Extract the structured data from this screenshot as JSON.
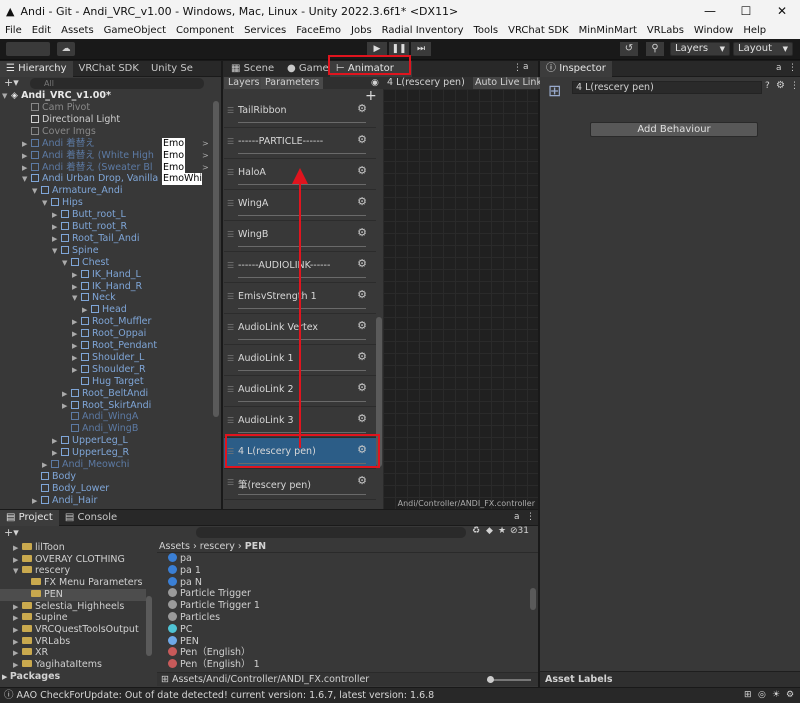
{
  "window": {
    "title": "Andi - Git - Andi_VRC_v1.00 - Windows, Mac, Linux - Unity 2022.3.6f1* <DX11>",
    "min": "—",
    "max": "☐",
    "close": "✕"
  },
  "menu": [
    "File",
    "Edit",
    "Assets",
    "GameObject",
    "Component",
    "Services",
    "FaceEmo",
    "Jobs",
    "Radial Inventory",
    "Tools",
    "VRChat SDK",
    "MinMinMart",
    "VRLabs",
    "Window",
    "Help"
  ],
  "toolbar": {
    "layers": "Layers",
    "layout": "Layout"
  },
  "hierarchy": {
    "tabs": [
      "Hierarchy",
      "VRChat SDK",
      "Unity Se"
    ],
    "search_placeholder": "All",
    "scene_name": "Andi_VRC_v1.00*",
    "rows": [
      {
        "text": "Cam Pivot",
        "indent": 2,
        "style": "dim",
        "arrow": ""
      },
      {
        "text": "Directional Light",
        "indent": 2,
        "style": "",
        "arrow": ""
      },
      {
        "text": "Cover Imgs",
        "indent": 2,
        "style": "dim",
        "arrow": ""
      },
      {
        "text": "Andi 着替え",
        "indent": 2,
        "style": "bluedim",
        "arrow": "▶",
        "badge": "Emo"
      },
      {
        "text": "Andi 着替え (White High",
        "indent": 2,
        "style": "bluedim",
        "arrow": "▶",
        "badge": "Emo"
      },
      {
        "text": "Andi 着替え (Sweater Bl",
        "indent": 2,
        "style": "bluedim",
        "arrow": "▶",
        "badge": "Emo"
      },
      {
        "text": "Andi Urban Drop, Vanilla",
        "indent": 2,
        "style": "blue",
        "arrow": "▼",
        "badge": "Emo",
        "badge2": "Whi"
      },
      {
        "text": "Armature_Andi",
        "indent": 3,
        "style": "blue",
        "arrow": "▼"
      },
      {
        "text": "Hips",
        "indent": 4,
        "style": "blue",
        "arrow": "▼"
      },
      {
        "text": "Butt_root_L",
        "indent": 5,
        "style": "blue",
        "arrow": "▶"
      },
      {
        "text": "Butt_root_R",
        "indent": 5,
        "style": "blue",
        "arrow": "▶"
      },
      {
        "text": "Root_Tail_Andi",
        "indent": 5,
        "style": "blue",
        "arrow": "▶"
      },
      {
        "text": "Spine",
        "indent": 5,
        "style": "blue",
        "arrow": "▼"
      },
      {
        "text": "Chest",
        "indent": 6,
        "style": "blue",
        "arrow": "▼"
      },
      {
        "text": "IK_Hand_L",
        "indent": 7,
        "style": "blue",
        "arrow": "▶"
      },
      {
        "text": "IK_Hand_R",
        "indent": 7,
        "style": "blue",
        "arrow": "▶"
      },
      {
        "text": "Neck",
        "indent": 7,
        "style": "blue",
        "arrow": "▼"
      },
      {
        "text": "Head",
        "indent": 8,
        "style": "blue",
        "arrow": "▶"
      },
      {
        "text": "Root_Muffler",
        "indent": 7,
        "style": "blue",
        "arrow": "▶"
      },
      {
        "text": "Root_Oppai",
        "indent": 7,
        "style": "blue",
        "arrow": "▶"
      },
      {
        "text": "Root_Pendant",
        "indent": 7,
        "style": "blue",
        "arrow": "▶"
      },
      {
        "text": "Shoulder_L",
        "indent": 7,
        "style": "blue",
        "arrow": "▶"
      },
      {
        "text": "Shoulder_R",
        "indent": 7,
        "style": "blue",
        "arrow": "▶"
      },
      {
        "text": "Hug Target",
        "indent": 7,
        "style": "blue",
        "arrow": ""
      },
      {
        "text": "Root_BeltAndi",
        "indent": 6,
        "style": "blue",
        "arrow": "▶"
      },
      {
        "text": "Root_SkirtAndi",
        "indent": 6,
        "style": "blue",
        "arrow": "▶"
      },
      {
        "text": "Andi_WingA",
        "indent": 6,
        "style": "bluedim",
        "arrow": ""
      },
      {
        "text": "Andi_WingB",
        "indent": 6,
        "style": "bluedim",
        "arrow": ""
      },
      {
        "text": "UpperLeg_L",
        "indent": 5,
        "style": "blue",
        "arrow": "▶"
      },
      {
        "text": "UpperLeg_R",
        "indent": 5,
        "style": "blue",
        "arrow": "▶"
      },
      {
        "text": "Andi_Meowchi",
        "indent": 4,
        "style": "bluedim",
        "arrow": "▶"
      },
      {
        "text": "Body",
        "indent": 3,
        "style": "blue",
        "arrow": ""
      },
      {
        "text": "Body_Lower",
        "indent": 3,
        "style": "blue",
        "arrow": ""
      },
      {
        "text": "Andi_Hair",
        "indent": 3,
        "style": "blue",
        "arrow": "▶"
      }
    ]
  },
  "center_tabs": {
    "scene": "Scene",
    "game": "Game",
    "animator": "Animator"
  },
  "animator": {
    "sub_tabs": [
      "Layers",
      "Parameters"
    ],
    "layer_name": "4 L(rescery pen)",
    "auto_live_link": "Auto Live Link",
    "add_symbol": "+",
    "params": [
      "TailRibbon",
      "------PARTICLE------",
      "HaloA",
      "WingA",
      "WingB",
      "------AUDIOLINK------",
      "EmisvStrength 1",
      "AudioLink Vertex",
      "AudioLink 1",
      "AudioLink 2",
      "AudioLink 3",
      "4 L(rescery pen)",
      "筆(rescery pen)"
    ],
    "selected_index": 11,
    "controller_path": "Andi/Controller/ANDI_FX.controller"
  },
  "inspector": {
    "tab": "Inspector",
    "object_name": "4 L(rescery pen)",
    "add_behaviour": "Add Behaviour",
    "asset_labels": "Asset Labels"
  },
  "project": {
    "tabs": [
      "Project",
      "Console"
    ],
    "count": "31",
    "folders": [
      {
        "name": "lilToon",
        "indent": 1,
        "arrow": "▶"
      },
      {
        "name": "OVERAY CLOTHING",
        "indent": 1,
        "arrow": "▶"
      },
      {
        "name": "rescery",
        "indent": 1,
        "arrow": "▼"
      },
      {
        "name": "FX Menu Parameters",
        "indent": 2,
        "arrow": ""
      },
      {
        "name": "PEN",
        "indent": 2,
        "arrow": "",
        "selected": true
      },
      {
        "name": "Selestia_Highheels",
        "indent": 1,
        "arrow": "▶"
      },
      {
        "name": "Supine",
        "indent": 1,
        "arrow": "▶"
      },
      {
        "name": "VRCQuestToolsOutput",
        "indent": 1,
        "arrow": "▶"
      },
      {
        "name": "VRLabs",
        "indent": 1,
        "arrow": "▶"
      },
      {
        "name": "XR",
        "indent": 1,
        "arrow": "▶"
      },
      {
        "name": "YagihataItems",
        "indent": 1,
        "arrow": "▶"
      }
    ],
    "packages": "Packages",
    "breadcrumb": [
      "Assets",
      "rescery",
      "PEN"
    ],
    "files": [
      {
        "name": "pa",
        "icon": "blue"
      },
      {
        "name": "pa 1",
        "icon": "blue"
      },
      {
        "name": "pa N",
        "icon": "blue"
      },
      {
        "name": "Particle Trigger",
        "icon": "gray"
      },
      {
        "name": "Particle Trigger 1",
        "icon": "gray"
      },
      {
        "name": "Particles",
        "icon": "gray"
      },
      {
        "name": "PC",
        "icon": "teal"
      },
      {
        "name": "PEN",
        "icon": "cube"
      },
      {
        "name": "Pen（English）",
        "icon": "red"
      },
      {
        "name": "Pen（English） 1",
        "icon": "red"
      }
    ],
    "status_path": "Assets/Andi/Controller/ANDI_FX.controller"
  },
  "statusbar": {
    "message": "AAO CheckForUpdate: Out of date detected! current version: 1.6.7, latest version: 1.6.8"
  }
}
